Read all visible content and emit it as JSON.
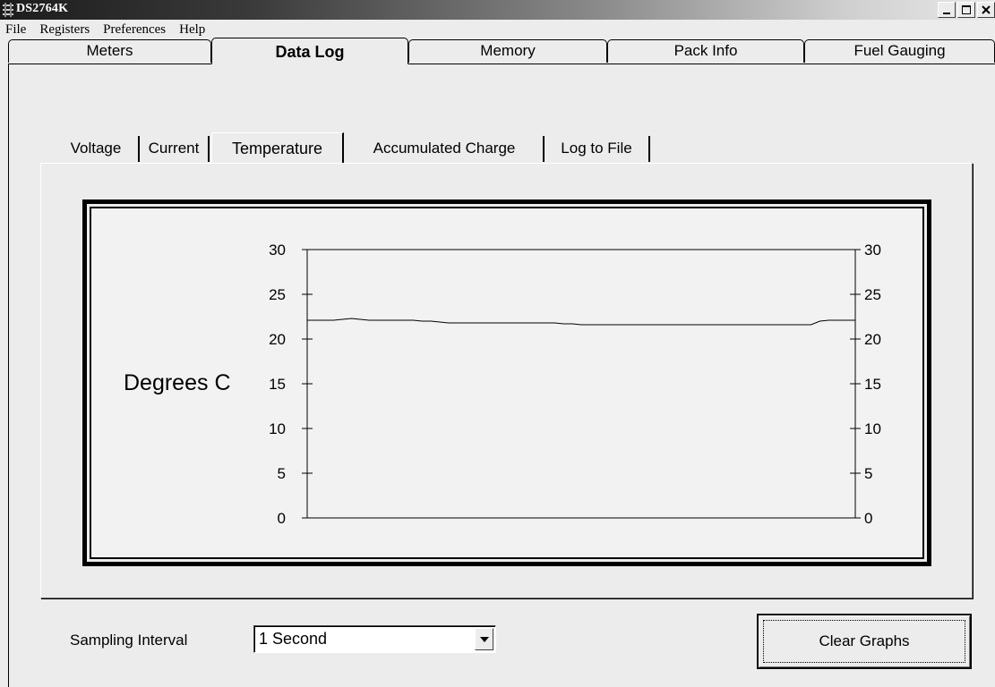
{
  "window": {
    "title": "DS2764K",
    "controls": [
      "_",
      "□",
      "×"
    ]
  },
  "menu": [
    "File",
    "Registers",
    "Preferences",
    "Help"
  ],
  "main_tabs": [
    {
      "label": "Meters",
      "active": false
    },
    {
      "label": "Data Log",
      "active": true
    },
    {
      "label": "Memory",
      "active": false
    },
    {
      "label": "Pack Info",
      "active": false
    },
    {
      "label": "Fuel Gauging",
      "active": false
    }
  ],
  "sub_tabs": [
    {
      "label": "Voltage",
      "active": false
    },
    {
      "label": "Current",
      "active": false
    },
    {
      "label": "Temperature",
      "active": true
    },
    {
      "label": "Accumulated Charge",
      "active": false
    },
    {
      "label": "Log to File",
      "active": false
    }
  ],
  "graph": {
    "ylabel": "Degrees C",
    "ticks": [
      "30",
      "25",
      "20",
      "15",
      "10",
      "5",
      "0"
    ]
  },
  "chart_data": {
    "type": "line",
    "title": "",
    "xlabel": "",
    "ylabel": "Degrees C",
    "ylim": [
      0,
      30
    ],
    "y_ticks": [
      0,
      5,
      10,
      15,
      20,
      25,
      30
    ],
    "series": [
      {
        "values": [
          22.1,
          22.1,
          22.1,
          22.1,
          22.2,
          22.3,
          22.2,
          22.1,
          22.1,
          22.1,
          22.1,
          22.1,
          22.1,
          22.0,
          22.0,
          21.9,
          21.8,
          21.8,
          21.8,
          21.8,
          21.8,
          21.8,
          21.8,
          21.8,
          21.8,
          21.8,
          21.8,
          21.8,
          21.8,
          21.7,
          21.7,
          21.6,
          21.6,
          21.6,
          21.6,
          21.6,
          21.6,
          21.6,
          21.6,
          21.6,
          21.6,
          21.6,
          21.6,
          21.6,
          21.6,
          21.6,
          21.6,
          21.6,
          21.6,
          21.6,
          21.6,
          21.6,
          21.6,
          21.6,
          21.6,
          21.6,
          21.6,
          21.6,
          22.0,
          22.1,
          22.1,
          22.1,
          22.1
        ]
      }
    ]
  },
  "controls": {
    "sampling_label": "Sampling Interval",
    "sampling_value": "1 Second",
    "clear_button": "Clear Graphs"
  }
}
